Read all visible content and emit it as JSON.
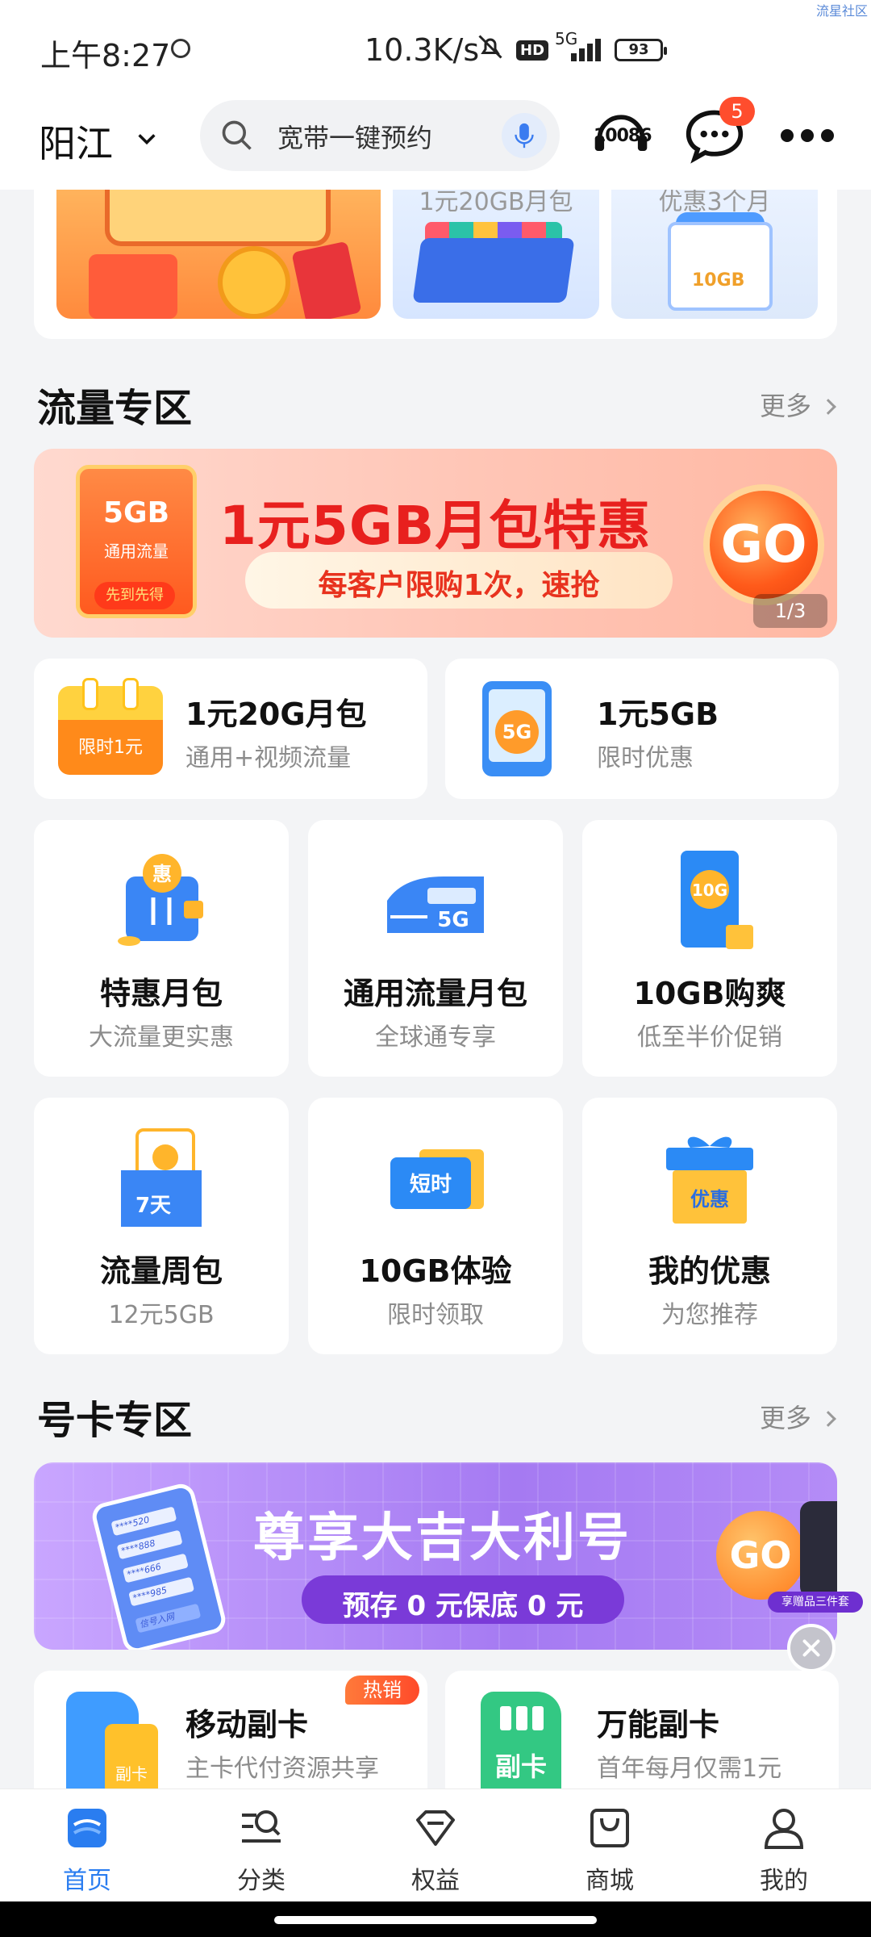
{
  "status_bar": {
    "time": "上午8:27",
    "speed": "10.3K/s",
    "hd": "HD",
    "network": "5G",
    "battery": "93",
    "corner_text": "流星社区"
  },
  "header": {
    "city": "阳江",
    "search_placeholder": "宽带一键预约",
    "service_label": "10086",
    "message_count": "5"
  },
  "top_banners": [
    {
      "caption": ""
    },
    {
      "caption": "1元20GB月包"
    },
    {
      "caption": "优惠3个月",
      "badge": "10GB"
    }
  ],
  "traffic_section": {
    "title": "流量专区",
    "more": "更多",
    "banner": {
      "pack_gb": "5GB",
      "pack_sub": "通用流量",
      "pack_tag": "先到先得",
      "title": "1元5GB月包特惠",
      "subtitle": "每客户限购1次，速抢",
      "go": "GO",
      "pager": "1/3"
    },
    "small_cards": [
      {
        "icon_text": "限时1元",
        "title": "1元20G月包",
        "subtitle": "通用+视频流量"
      },
      {
        "icon_text": "5G",
        "title": "1元5GB",
        "subtitle": "限时优惠"
      }
    ],
    "grid": [
      {
        "title": "特惠月包",
        "subtitle": "大流量更实惠",
        "icon": "wallet-icon",
        "icon_text": "惠"
      },
      {
        "title": "通用流量月包",
        "subtitle": "全球通专享",
        "icon": "train-icon",
        "icon_text": "5G"
      },
      {
        "title": "10GB购爽",
        "subtitle": "低至半价促销",
        "icon": "data-card-icon",
        "icon_text": "10G"
      },
      {
        "title": "流量周包",
        "subtitle": "12元5GB",
        "icon": "weekly-pack-icon",
        "icon_text": "7天"
      },
      {
        "title": "10GB体验",
        "subtitle": "限时领取",
        "icon": "ticket-icon",
        "icon_text": "短时"
      },
      {
        "title": "我的优惠",
        "subtitle": "为您推荐",
        "icon": "gift-box-icon",
        "icon_text": "优惠"
      }
    ]
  },
  "number_section": {
    "title": "号卡专区",
    "more": "更多",
    "banner": {
      "title": "尊享大吉大利号",
      "subtitle": "预存 0 元保底 0 元",
      "go": "GO",
      "tag": "享赠品三件套",
      "phone_numbers": [
        "****520",
        "****888",
        "****666",
        "****985"
      ],
      "phone_button": "信号入网"
    },
    "cards": [
      {
        "title": "移动副卡",
        "subtitle": "主卡代付资源共享",
        "badge": "热销",
        "icon_text": "副卡"
      },
      {
        "title": "万能副卡",
        "subtitle": "首年每月仅需1元",
        "icon_text": "副卡"
      }
    ]
  },
  "tabbar": [
    {
      "label": "首页",
      "icon": "home-icon",
      "active": true
    },
    {
      "label": "分类",
      "icon": "category-icon",
      "active": false
    },
    {
      "label": "权益",
      "icon": "diamond-icon",
      "active": false
    },
    {
      "label": "商城",
      "icon": "shop-bag-icon",
      "active": false
    },
    {
      "label": "我的",
      "icon": "person-icon",
      "active": false
    }
  ],
  "colors": {
    "accent": "#2a7df0",
    "promo_red": "#e8201e",
    "badge": "#ff4d2d"
  }
}
